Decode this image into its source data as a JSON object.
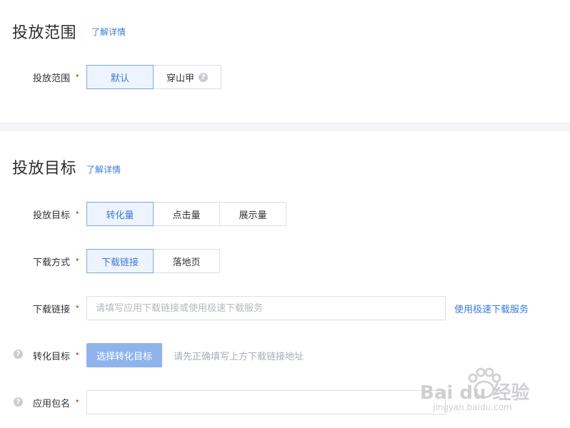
{
  "section1": {
    "title": "投放范围",
    "detail_link": "了解详情",
    "field_label": "投放范围",
    "options": [
      "默认",
      "穿山甲"
    ],
    "selected": "默认"
  },
  "section2": {
    "title": "投放目标",
    "detail_link": "了解详情",
    "goal": {
      "label": "投放目标",
      "options": [
        "转化量",
        "点击量",
        "展示量"
      ],
      "selected": "转化量"
    },
    "download_method": {
      "label": "下载方式",
      "options": [
        "下载链接",
        "落地页"
      ],
      "selected": "下载链接"
    },
    "download_link": {
      "label": "下载链接",
      "value": "",
      "placeholder": "请填写应用下载链接或使用极速下载服务",
      "side_link": "使用极速下载服务"
    },
    "conversion_goal": {
      "label": "转化目标",
      "button": "选择转化目标",
      "hint": "请先正确填写上方下载链接地址"
    },
    "package_name": {
      "label": "应用包名",
      "value": ""
    }
  },
  "watermark": {
    "logo": "Bai du 经验",
    "url": "jingyan.baidu.com"
  },
  "colors": {
    "accent": "#3d7ad6",
    "required": "#e0492f",
    "disabled_primary": "#8fb4ec"
  }
}
